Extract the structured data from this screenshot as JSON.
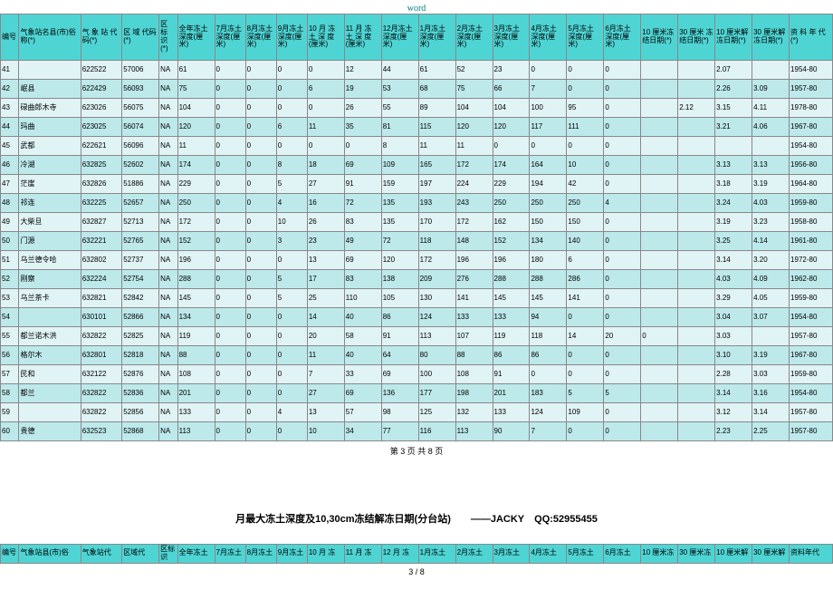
{
  "word_label": "word",
  "pager": "第 3 页 共 8 页",
  "footer_page": "3 / 8",
  "title2": "月最大冻土深度及10,30cm冻结解冻日期(分台站)  ——JACKY QQ:52955455",
  "headers": [
    "编号",
    "气象站名县(市)俗称(*)",
    "气 象 站 代码(*)",
    "区 域 代码(*)",
    "区 标 识 (*)",
    "全年冻土 深度(厘 米)",
    "7月冻土 深度(厘 米)",
    "8月冻土 深度(厘 米)",
    "9月冻土 深度(厘 米)",
    "10 月 冻 土 深 度 (厘米)",
    "11 月 冻 土 深 度 (厘米)",
    "12月冻土 深度(厘 米)",
    "1月冻土 深度(厘 米)",
    "2月冻土 深度(厘 米)",
    "3月冻土 深度(厘 米)",
    "4月冻土 深度(厘 米)",
    "5月冻土 深度(厘 米)",
    "6月冻土 深度(厘 米)",
    "10 厘米冻 结日期(*)",
    "30 厘米 冻 结日期(*)",
    "10 厘米解 冻日期(*)",
    "30 厘米解 冻日期(*)",
    "资 料 年 代(*)"
  ],
  "headers2": [
    "编号",
    "气象站县(市)俗",
    "气象站代",
    "区域代",
    "区标识",
    "全年冻土",
    "7月冻土",
    "8月冻土",
    "9月冻土",
    "10 月 冻",
    "11 月 冻",
    "12 月 冻",
    "1月冻土",
    "2月冻土",
    "3月冻土",
    "4月冻土",
    "5月冻土",
    "6月冻土",
    "10 厘米冻",
    "30 厘米冻",
    "10 厘米解",
    "30 厘米解",
    "资料年代"
  ],
  "rows": [
    [
      "41",
      "",
      "622522",
      "57006",
      "NA",
      "61",
      "0",
      "0",
      "0",
      "0",
      "12",
      "44",
      "61",
      "52",
      "23",
      "0",
      "0",
      "0",
      "",
      "",
      "2.07",
      "",
      "1954-80"
    ],
    [
      "42",
      "岷县",
      "622429",
      "56093",
      "NA",
      "75",
      "0",
      "0",
      "0",
      "6",
      "19",
      "53",
      "68",
      "75",
      "66",
      "7",
      "0",
      "0",
      "",
      "",
      "2.26",
      "3.09",
      "1957-80"
    ],
    [
      "43",
      "碌曲郎木寺",
      "623026",
      "56075",
      "NA",
      "104",
      "0",
      "0",
      "0",
      "0",
      "26",
      "55",
      "89",
      "104",
      "104",
      "100",
      "95",
      "0",
      "",
      "2.12",
      "3.15",
      "4.11",
      "1978-80"
    ],
    [
      "44",
      "玛曲",
      "623025",
      "56074",
      "NA",
      "120",
      "0",
      "0",
      "6",
      "11",
      "35",
      "81",
      "115",
      "120",
      "120",
      "117",
      "111",
      "0",
      "",
      "",
      "3.21",
      "4.06",
      "1967-80"
    ],
    [
      "45",
      "武都",
      "622621",
      "56096",
      "NA",
      "11",
      "0",
      "0",
      "0",
      "0",
      "0",
      "8",
      "11",
      "11",
      "0",
      "0",
      "0",
      "0",
      "",
      "",
      "",
      "",
      "1954-80"
    ],
    [
      "46",
      "冷湖",
      "632825",
      "52602",
      "NA",
      "174",
      "0",
      "0",
      "8",
      "18",
      "69",
      "109",
      "165",
      "172",
      "174",
      "164",
      "10",
      "0",
      "",
      "",
      "3.13",
      "3.13",
      "1956-80"
    ],
    [
      "47",
      "茫崖",
      "632826",
      "51886",
      "NA",
      "229",
      "0",
      "0",
      "5",
      "27",
      "91",
      "159",
      "197",
      "224",
      "229",
      "194",
      "42",
      "0",
      "",
      "",
      "3.18",
      "3.19",
      "1964-80"
    ],
    [
      "48",
      "祁连",
      "632225",
      "52657",
      "NA",
      "250",
      "0",
      "0",
      "4",
      "16",
      "72",
      "135",
      "193",
      "243",
      "250",
      "250",
      "250",
      "4",
      "",
      "",
      "3.24",
      "4.03",
      "1959-80"
    ],
    [
      "49",
      "大柴旦",
      "632827",
      "52713",
      "NA",
      "172",
      "0",
      "0",
      "10",
      "26",
      "83",
      "135",
      "170",
      "172",
      "162",
      "150",
      "150",
      "0",
      "",
      "",
      "3.19",
      "3.23",
      "1958-80"
    ],
    [
      "50",
      "门源",
      "632221",
      "52765",
      "NA",
      "152",
      "0",
      "0",
      "3",
      "23",
      "49",
      "72",
      "118",
      "148",
      "152",
      "134",
      "140",
      "0",
      "",
      "",
      "3.25",
      "4.14",
      "1961-80"
    ],
    [
      "51",
      "乌兰德令哈",
      "632802",
      "52737",
      "NA",
      "196",
      "0",
      "0",
      "0",
      "13",
      "69",
      "120",
      "172",
      "196",
      "196",
      "180",
      "6",
      "0",
      "",
      "",
      "3.14",
      "3.20",
      "1972-80"
    ],
    [
      "52",
      "刚察",
      "632224",
      "52754",
      "NA",
      "288",
      "0",
      "0",
      "5",
      "17",
      "83",
      "138",
      "209",
      "276",
      "288",
      "288",
      "286",
      "0",
      "",
      "",
      "4.03",
      "4.09",
      "1962-80"
    ],
    [
      "53",
      "乌兰茶卡",
      "632821",
      "52842",
      "NA",
      "145",
      "0",
      "0",
      "5",
      "25",
      "110",
      "105",
      "130",
      "141",
      "145",
      "145",
      "141",
      "0",
      "",
      "",
      "3.29",
      "4.05",
      "1959-80"
    ],
    [
      "54",
      "",
      "630101",
      "52866",
      "NA",
      "134",
      "0",
      "0",
      "0",
      "14",
      "40",
      "86",
      "124",
      "133",
      "133",
      "94",
      "0",
      "0",
      "",
      "",
      "3.04",
      "3.07",
      "1954-80"
    ],
    [
      "55",
      "都兰诺木洪",
      "632822",
      "52825",
      "NA",
      "119",
      "0",
      "0",
      "0",
      "20",
      "58",
      "91",
      "113",
      "107",
      "119",
      "118",
      "14",
      "20",
      "0",
      "",
      "3.03",
      "",
      "1957-80"
    ],
    [
      "56",
      "格尔木",
      "632801",
      "52818",
      "NA",
      "88",
      "0",
      "0",
      "0",
      "11",
      "40",
      "64",
      "80",
      "88",
      "86",
      "86",
      "0",
      "0",
      "",
      "",
      "3.10",
      "3.19",
      "1967-80"
    ],
    [
      "57",
      "民和",
      "632122",
      "52876",
      "NA",
      "108",
      "0",
      "0",
      "0",
      "7",
      "33",
      "69",
      "100",
      "108",
      "91",
      "0",
      "0",
      "0",
      "",
      "",
      "2.28",
      "3.03",
      "1959-80"
    ],
    [
      "58",
      "都兰",
      "632822",
      "52836",
      "NA",
      "201",
      "0",
      "0",
      "0",
      "27",
      "69",
      "136",
      "177",
      "198",
      "201",
      "183",
      "5",
      "5",
      "",
      "",
      "3.14",
      "3.16",
      "1954-80"
    ],
    [
      "59",
      "",
      "632822",
      "52856",
      "NA",
      "133",
      "0",
      "0",
      "4",
      "13",
      "57",
      "98",
      "125",
      "132",
      "133",
      "124",
      "109",
      "0",
      "",
      "",
      "3.12",
      "3.14",
      "1957-80"
    ],
    [
      "60",
      "贵德",
      "632523",
      "52868",
      "NA",
      "113",
      "0",
      "0",
      "0",
      "10",
      "34",
      "77",
      "116",
      "113",
      "90",
      "7",
      "0",
      "0",
      "",
      "",
      "2.23",
      "2.25",
      "1957-80"
    ]
  ]
}
